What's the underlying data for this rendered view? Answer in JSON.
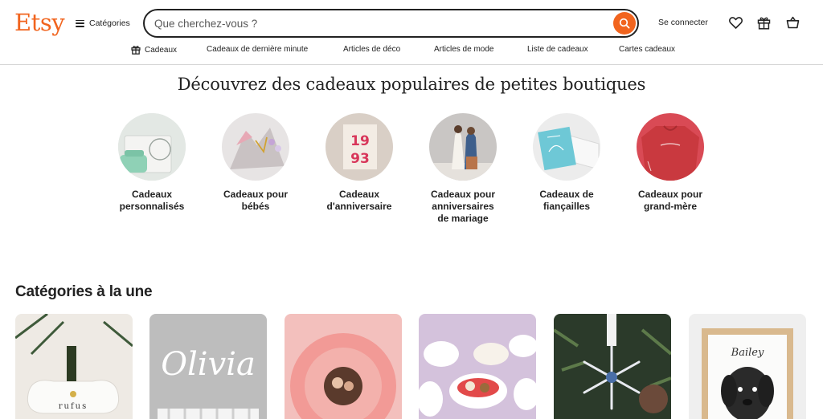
{
  "header": {
    "logo": "Etsy",
    "categories_label": "Catégories",
    "search": {
      "placeholder": "Que cherchez-vous ?",
      "value": ""
    },
    "sign_in": "Se connecter",
    "icons": [
      "search-icon",
      "heart-icon",
      "gift-icon",
      "cart-icon"
    ]
  },
  "subnav": [
    {
      "label": "Cadeaux",
      "icon": "gift-icon"
    },
    {
      "label": "Cadeaux de dernière minute"
    },
    {
      "label": "Articles de déco"
    },
    {
      "label": "Articles de mode"
    },
    {
      "label": "Liste de cadeaux"
    },
    {
      "label": "Cartes cadeaux"
    }
  ],
  "gifts": {
    "title": "Découvrez des cadeaux populaires de petites boutiques",
    "items": [
      {
        "line1": "Cadeaux",
        "line2": "personnalisés",
        "line3": ""
      },
      {
        "line1": "Cadeaux pour",
        "line2": "bébés",
        "line3": ""
      },
      {
        "line1": "Cadeaux",
        "line2": "d'anniversaire",
        "line3": ""
      },
      {
        "line1": "Cadeaux pour",
        "line2": "anniversaires",
        "line3": "de mariage"
      },
      {
        "line1": "Cadeaux de",
        "line2": "fiançailles",
        "line3": ""
      },
      {
        "line1": "Cadeaux pour",
        "line2": "grand-mère",
        "line3": ""
      }
    ]
  },
  "categories": {
    "title": "Catégories à la une",
    "cards": [
      {
        "image_text": "rufus"
      },
      {
        "image_text": "Olivia"
      },
      {
        "image_text": ""
      },
      {
        "image_text": ""
      },
      {
        "image_text": ""
      },
      {
        "image_text": "Bailey"
      }
    ]
  },
  "colors": {
    "accent": "#f1641e",
    "text": "#222222"
  }
}
